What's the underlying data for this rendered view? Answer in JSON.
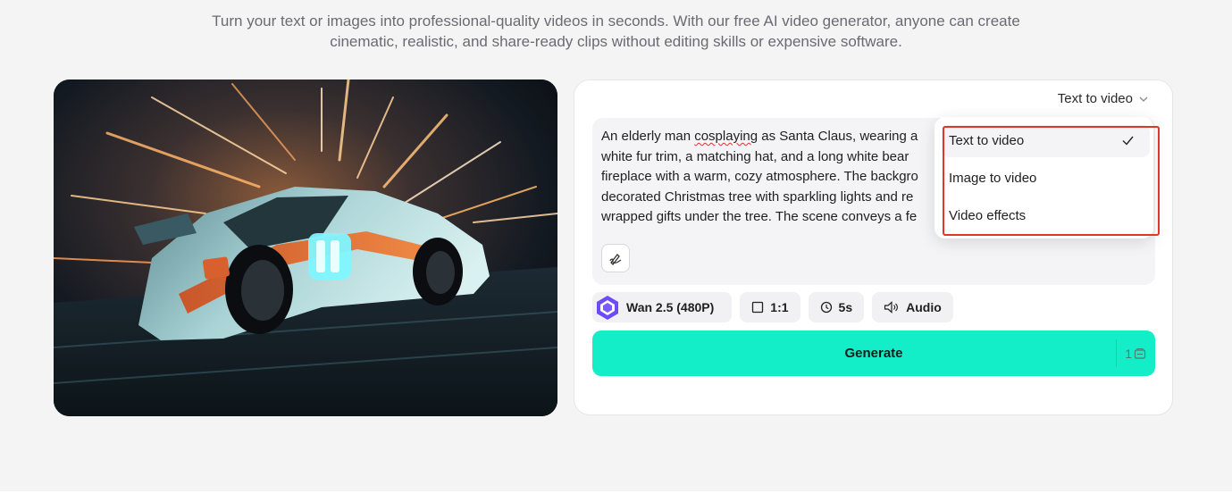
{
  "intro": {
    "line1": "Turn your text or images into professional-quality videos in seconds. With our free AI video generator, anyone can create",
    "line2": "cinematic, realistic, and share-ready clips without editing skills or expensive software."
  },
  "mode_select": {
    "label": "Text to video",
    "icon": "chevron-down-icon"
  },
  "prompt": {
    "text_before": "An elderly man ",
    "misspelled": "cosplaying",
    "text_after": " as Santa Claus, wearing a\nwhite fur trim, a matching hat, and a long white bear\nfireplace with a warm, cozy atmosphere. The backgro\ndecorated Christmas tree with sparkling lights and re\nwrapped gifts under the tree. The scene conveys a fe",
    "enhance_icon": "magic-pen-icon"
  },
  "options": {
    "model": "Wan 2.5  (480P)",
    "model_icon": "wan-logo-icon",
    "ratio": "1:1",
    "ratio_icon": "square-icon",
    "duration": "5s",
    "duration_icon": "clock-icon",
    "audio": "Audio",
    "audio_icon": "speaker-icon"
  },
  "generate": {
    "label": "Generate",
    "cost": "1",
    "cost_icon": "credit-icon"
  },
  "dropdown": {
    "items": [
      {
        "label": "Text to video",
        "selected": true
      },
      {
        "label": "Image to video",
        "selected": false
      },
      {
        "label": "Video effects",
        "selected": false
      }
    ]
  },
  "colors": {
    "accent": "#14eec8",
    "highlight": "#e0372c",
    "page_bg": "#f4f4f5"
  }
}
